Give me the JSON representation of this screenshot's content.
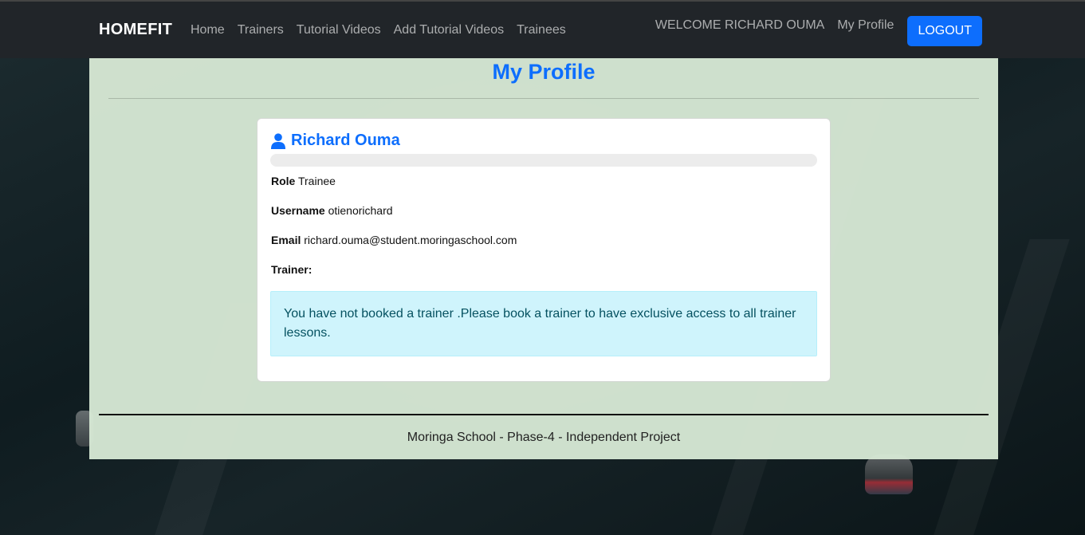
{
  "navbar": {
    "brand": "HOMEFIT",
    "links": [
      "Home",
      "Trainers",
      "Tutorial Videos",
      "Add Tutorial Videos",
      "Trainees"
    ],
    "welcome": "WELCOME RICHARD OUMA",
    "my_profile": "My Profile",
    "logout": "LOGOUT"
  },
  "page": {
    "title": "My Profile"
  },
  "profile": {
    "name": "Richard Ouma",
    "role_label": "Role",
    "role": "Trainee",
    "username_label": "Username",
    "username": "otienorichard",
    "email_label": "Email",
    "email": "richard.ouma@student.moringaschool.com",
    "trainer_label": "Trainer:",
    "alert": "You have not booked a trainer .Please book a trainer to have exclusive access to all trainer lessons."
  },
  "footer": {
    "text": "Moringa School - Phase-4 - Independent Project"
  },
  "colors": {
    "primary": "#0d6efd",
    "navbar": "#212529",
    "alert_bg": "#cff4fc",
    "alert_text": "#055160",
    "container_bg": "#d6e8d4"
  },
  "icons": {
    "user": "user-icon"
  }
}
